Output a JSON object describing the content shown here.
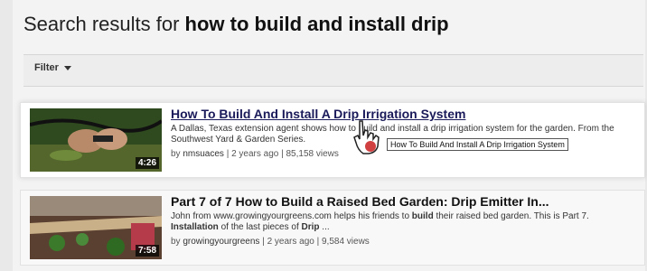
{
  "heading": {
    "prefix": "Search results for ",
    "query": "how to build and install drip"
  },
  "filter": {
    "label": "Filter"
  },
  "results": [
    {
      "title": "How To Build And Install A Drip Irrigation System",
      "description": "A Dallas, Texas extension agent shows how to build and install a drip irrigation system for the garden. From the Southwest Yard & Garden Series.",
      "channel": "nmsuaces",
      "age": "2 years ago",
      "views": "85,158 views",
      "duration": "4:26"
    },
    {
      "title": "Part 7 of 7 How to Build a Raised Bed Garden: Drip Emitter In...",
      "description_parts": [
        "John from www.growingyourgreens.com helps his friends to ",
        "build",
        " their raised bed garden. This is Part 7. ",
        "Installation",
        " of the last pieces of ",
        "Drip",
        " ..."
      ],
      "channel": "growingyourgreens",
      "age": "2 years ago",
      "views": "9,584 views",
      "duration": "7:58"
    }
  ],
  "tooltip": "How To Build And Install A Drip Irrigation System"
}
